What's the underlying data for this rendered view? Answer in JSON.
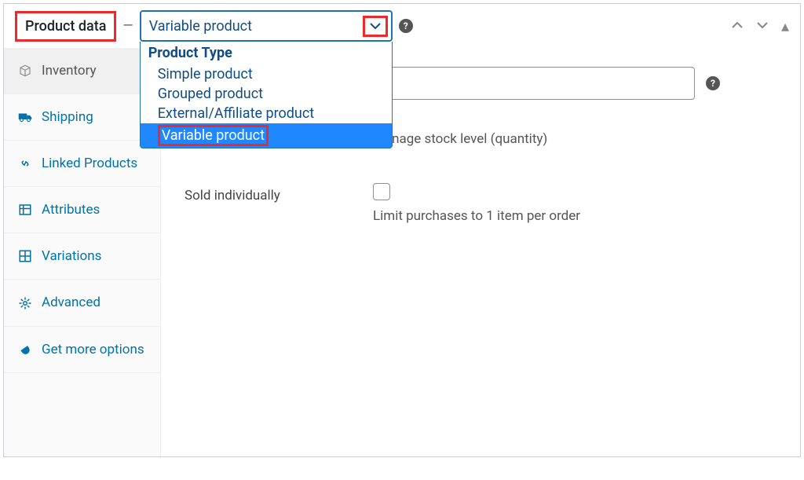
{
  "panel": {
    "title": "Product data",
    "dash": "—"
  },
  "select": {
    "selected": "Variable product",
    "group_label": "Product Type",
    "options": [
      "Simple product",
      "Grouped product",
      "External/Affiliate product",
      "Variable product"
    ]
  },
  "sidebar": {
    "items": [
      {
        "label": "Inventory"
      },
      {
        "label": "Shipping"
      },
      {
        "label": "Linked Products"
      },
      {
        "label": "Attributes"
      },
      {
        "label": "Variations"
      },
      {
        "label": "Advanced"
      },
      {
        "label": "Get more options"
      }
    ]
  },
  "form": {
    "sku_value": "",
    "manage_stock_desc": "Manage stock level (quantity)",
    "sold_individually_label": "Sold individually",
    "sold_individually_desc": "Limit purchases to 1 item per order"
  },
  "icons": {
    "help": "?",
    "up": "▴",
    "down": "▾"
  }
}
